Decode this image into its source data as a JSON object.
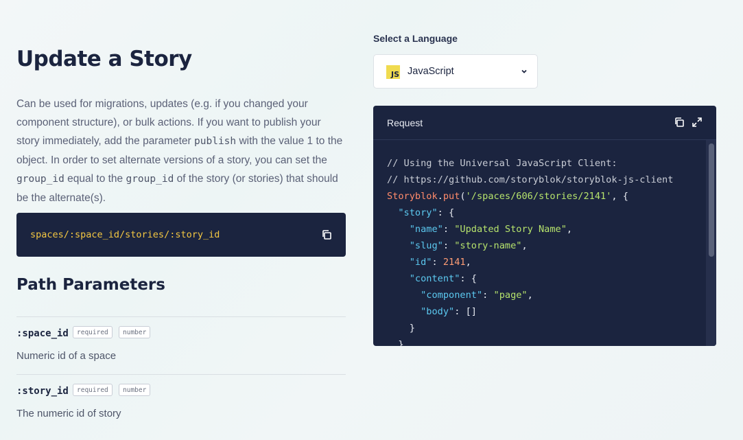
{
  "page": {
    "title": "Update a Story",
    "description": {
      "part1": "Can be used for migrations, updates (e.g. if you changed your component structure), or bulk actions. If you want to publish your story immediately, add the parameter ",
      "code1": "publish",
      "part2": " with the value 1 to the object. In order to set alternate versions of a story, you can set the ",
      "code2": "group_id",
      "part3": " equal to the ",
      "code3": "group_id",
      "part4": " of the story (or stories) that should be the alternate(s)."
    },
    "endpoint": "spaces/:space_id/stories/:story_id",
    "path_params_heading": "Path Parameters",
    "params": [
      {
        "name": ":space_id",
        "required": "required",
        "type": "number",
        "description": "Numeric id of a space"
      },
      {
        "name": ":story_id",
        "required": "required",
        "type": "number",
        "description": "The numeric id of story"
      }
    ]
  },
  "language": {
    "label": "Select a Language",
    "logo_text": "JS",
    "selected": "JavaScript"
  },
  "request": {
    "label": "Request",
    "code": {
      "comment1": "// Using the Universal JavaScript Client:",
      "comment2": "// https://github.com/storyblok/storyblok-js-client",
      "obj": "Storyblok",
      "method": "put",
      "url": "'/spaces/606/stories/2141'",
      "k_story": "\"story\"",
      "k_name": "\"name\"",
      "v_name": "\"Updated Story Name\"",
      "k_slug": "\"slug\"",
      "v_slug": "\"story-name\"",
      "k_id": "\"id\"",
      "v_id": "2141",
      "k_content": "\"content\"",
      "k_component": "\"component\"",
      "v_component": "\"page\"",
      "k_body": "\"body\"",
      "v_body": "[]"
    }
  },
  "colors": {
    "dark_panel": "#1b243f",
    "endpoint_text": "#f5c842",
    "string": "#b6e36c",
    "key": "#5cc9f0",
    "function": "#ff8b6b"
  },
  "icons": [
    "copy-icon",
    "expand-icon",
    "chevron-down-icon",
    "javascript-logo-icon"
  ]
}
